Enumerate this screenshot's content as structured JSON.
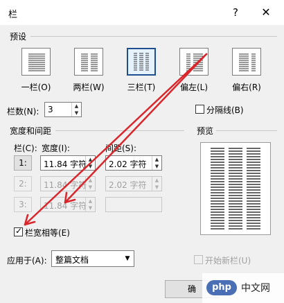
{
  "dialog": {
    "title": "栏",
    "help": "?",
    "close": "✕"
  },
  "presets": {
    "label": "预设",
    "items": [
      {
        "label": "一栏(O)",
        "icon": "one-column-icon",
        "selected": false
      },
      {
        "label": "两栏(W)",
        "icon": "two-columns-icon",
        "selected": false
      },
      {
        "label": "三栏(T)",
        "icon": "three-columns-icon",
        "selected": true
      },
      {
        "label": "偏左(L)",
        "icon": "left-column-icon",
        "selected": false
      },
      {
        "label": "偏右(R)",
        "icon": "right-column-icon",
        "selected": false
      }
    ]
  },
  "column_count": {
    "label": "栏数(N):",
    "value": "3"
  },
  "separator": {
    "label": "分隔线(B)",
    "checked": false
  },
  "width_spacing": {
    "label": "宽度和间距",
    "col_header": "栏(C):",
    "width_header": "宽度(I):",
    "spacing_header": "间距(S):",
    "rows": [
      {
        "num": "1:",
        "width": "11.84 字符",
        "spacing": "2.02 字符",
        "disabled": false
      },
      {
        "num": "2:",
        "width": "11.84 字符",
        "spacing": "2.02 字符",
        "disabled": true
      },
      {
        "num": "3:",
        "width": "11.84 字符",
        "spacing": "",
        "disabled": true
      }
    ]
  },
  "equal_width": {
    "label": "栏宽相等(E)",
    "checked": true
  },
  "preview": {
    "label": "预览"
  },
  "apply_to": {
    "label": "应用于(A):",
    "value": "整篇文档"
  },
  "new_column": {
    "label": "开始新栏(U)",
    "checked": false,
    "disabled": true
  },
  "buttons": {
    "ok": "确"
  },
  "watermark": {
    "logo": "php",
    "text": "中文网"
  },
  "colors": {
    "annotation_arrow": "#d9262b",
    "selected_border": "#1e4e8c"
  }
}
